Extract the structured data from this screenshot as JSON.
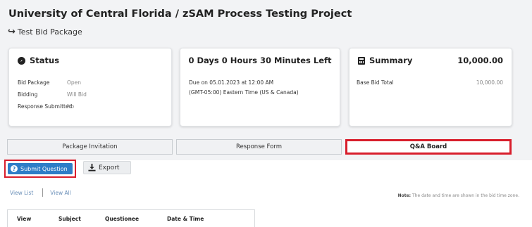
{
  "header": {
    "title": "University of Central Florida / zSAM Process Testing Project",
    "subtitle": "Test Bid Package"
  },
  "status_card": {
    "title": "Status",
    "rows": [
      {
        "key": "Bid Package",
        "value": "Open"
      },
      {
        "key": "Bidding",
        "value": "Will Bid"
      },
      {
        "key": "Response Submitted",
        "value": "No"
      }
    ]
  },
  "time_card": {
    "title": "0 Days 0 Hours 30 Minutes Left",
    "due": "Due on 05.01.2023 at 12:00 AM",
    "timezone": "(GMT-05:00) Eastern Time (US & Canada)"
  },
  "summary_card": {
    "title": "Summary",
    "total": "10,000.00",
    "rows": [
      {
        "key": "Base Bid Total",
        "value": "10,000.00"
      }
    ]
  },
  "tabs": [
    {
      "label": "Package Invitation"
    },
    {
      "label": "Response Form"
    },
    {
      "label": "Q&A Board"
    }
  ],
  "toolbar": {
    "submit_label": "Submit Question",
    "export_label": "Export"
  },
  "view_links": {
    "view_list": "View List",
    "view_all": "View All"
  },
  "note": {
    "label": "Note:",
    "text": "The date and time are shown in the bid time zone."
  },
  "table": {
    "columns": [
      "View",
      "Subject",
      "Questionee",
      "Date & Time"
    ]
  },
  "colors": {
    "accent": "#2e7dc7",
    "highlight": "#d81e2c"
  }
}
